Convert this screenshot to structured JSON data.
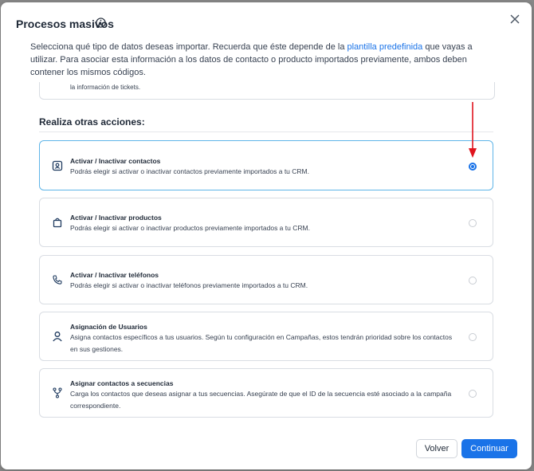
{
  "dialog": {
    "title": "Procesos masivos",
    "description_before_link": "Selecciona qué tipo de datos deseas importar. Recuerda que éste depende de la ",
    "description_link": "plantilla predefinida",
    "description_after_link": " que vayas a utilizar. Para asociar esta información a los datos de contacto o producto importados previamente, ambos deben contener los mismos códigos."
  },
  "previous_card": {
    "text": "la información de tickets."
  },
  "section": {
    "title": "Realiza otras acciones:"
  },
  "options": [
    {
      "title": "Activar / Inactivar contactos",
      "description": "Podrás elegir si activar o inactivar contactos previamente importados a tu CRM.",
      "icon": "contact-card-icon",
      "selected": true
    },
    {
      "title": "Activar / Inactivar productos",
      "description": "Podrás elegir si activar o inactivar productos previamente importados a tu CRM.",
      "icon": "shopping-bag-icon",
      "selected": false
    },
    {
      "title": "Activar / Inactivar teléfonos",
      "description": "Podrás elegir si activar o inactivar teléfonos previamente importados a tu CRM.",
      "icon": "phone-icon",
      "selected": false
    },
    {
      "title": "Asignación de Usuarios",
      "description": "Asigna contactos específicos a tus usuarios. Según tu configuración en Campañas, estos tendrán prioridad sobre los contactos en sus gestiones.",
      "icon": "user-icon",
      "selected": false
    },
    {
      "title": "Asignar contactos a secuencias",
      "description": "Carga los contactos que deseas asignar a tus secuencias. Asegúrate de que el ID de la secuencia esté asociado a la campaña correspondiente.",
      "icon": "sequence-branch-icon",
      "selected": false
    }
  ],
  "footer": {
    "back_label": "Volver",
    "continue_label": "Continuar"
  },
  "colors": {
    "primary": "#1a73e8",
    "selected_border": "#5fb5e8",
    "annotation_arrow": "#e0141e",
    "icon": "#1e3a5f"
  }
}
